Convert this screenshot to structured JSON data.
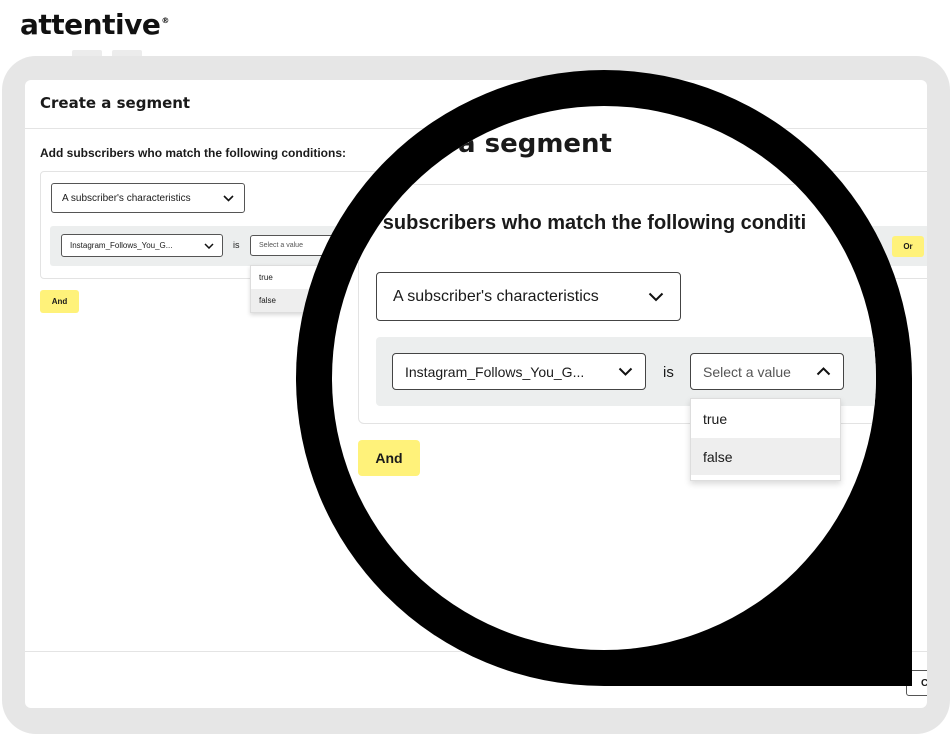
{
  "brand": {
    "logo_text": "attentive",
    "logo_mark": "®"
  },
  "modal": {
    "title": "Create a segment",
    "conditions_heading": "Add subscribers who match the following conditions:",
    "condition_type_select": "A subscriber's characteristics",
    "attribute_select": "Instagram_Follows_You_G...",
    "operator_label": "is",
    "value_select_placeholder": "Select a value",
    "value_options": [
      "true",
      "false"
    ],
    "highlighted_option": "false",
    "and_button": "And",
    "or_button": "Or",
    "footer_button_partial": "C"
  },
  "magnifier": {
    "title_partial": "a segment",
    "heading_partial": "d subscribers who match the following conditi"
  },
  "colors": {
    "accent_yellow": "#fff27a",
    "frame_gray": "#e6e6e6",
    "row_bg": "#eceeee",
    "lens": "#000000"
  },
  "icons": [
    "chevron-down-icon",
    "chevron-up-icon"
  ]
}
